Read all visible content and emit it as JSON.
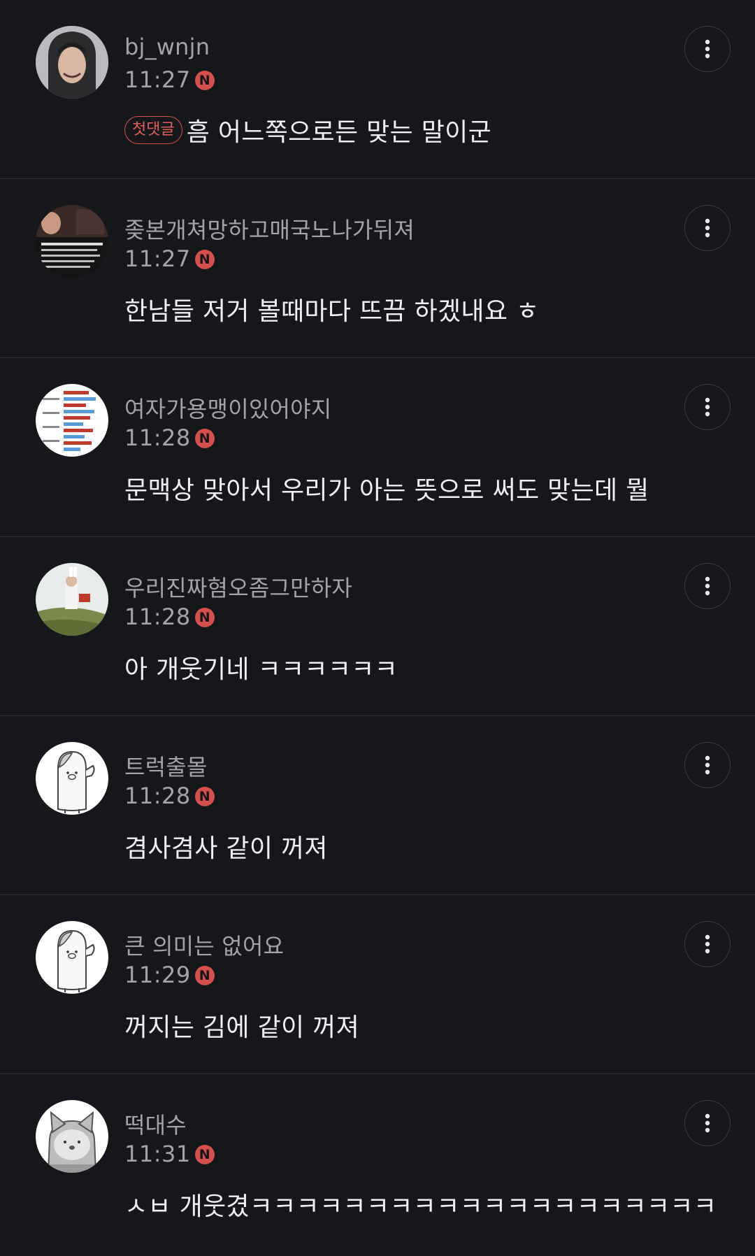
{
  "comments": [
    {
      "nickname": "bj_wnjn",
      "time": "11:27",
      "new_badge": "N",
      "first_tag": "첫댓글",
      "text": "흠 어느쪽으로든 맞는 말이군",
      "avatar": "user-photo"
    },
    {
      "nickname": "좆본개쳐망하고매국노나가뒤져",
      "time": "11:27",
      "new_badge": "N",
      "text": "한남들 저거 볼때마다 뜨끔 하겠내요 ㅎ",
      "avatar": "news-photo"
    },
    {
      "nickname": "여자가용맹이있어야지",
      "time": "11:28",
      "new_badge": "N",
      "text": "문맥상 맞아서 우리가 아는 뜻으로 써도 맞는데 뭘",
      "avatar": "bar-chart-image"
    },
    {
      "nickname": "우리진짜혐오좀그만하자",
      "time": "11:28",
      "new_badge": "N",
      "text": "아 개웃기네 ㅋㅋㅋㅋㅋㅋ",
      "avatar": "outdoor-photo"
    },
    {
      "nickname": "트럭출몰",
      "time": "11:28",
      "new_badge": "N",
      "text": "겸사겸사 같이 꺼져",
      "avatar": "default-character"
    },
    {
      "nickname": "큰 의미는 없어요",
      "time": "11:29",
      "new_badge": "N",
      "text": "꺼지는 김에 같이 꺼져",
      "avatar": "default-character"
    },
    {
      "nickname": "떡대수",
      "time": "11:31",
      "new_badge": "N",
      "text": "ㅅㅂ 개웃�史ㅋㅋㅋㅋㅋㅋㅋㅋㅋㅋㅋㅋㅋㅋㅋㅋㅋㅋㅋㅋ",
      "avatar": "cat-character"
    }
  ],
  "colors": {
    "background": "#16171b",
    "divider": "#2c2d31",
    "accent": "#d6504b",
    "text_primary": "#f0f0f2",
    "text_secondary": "#a3a4a9"
  }
}
